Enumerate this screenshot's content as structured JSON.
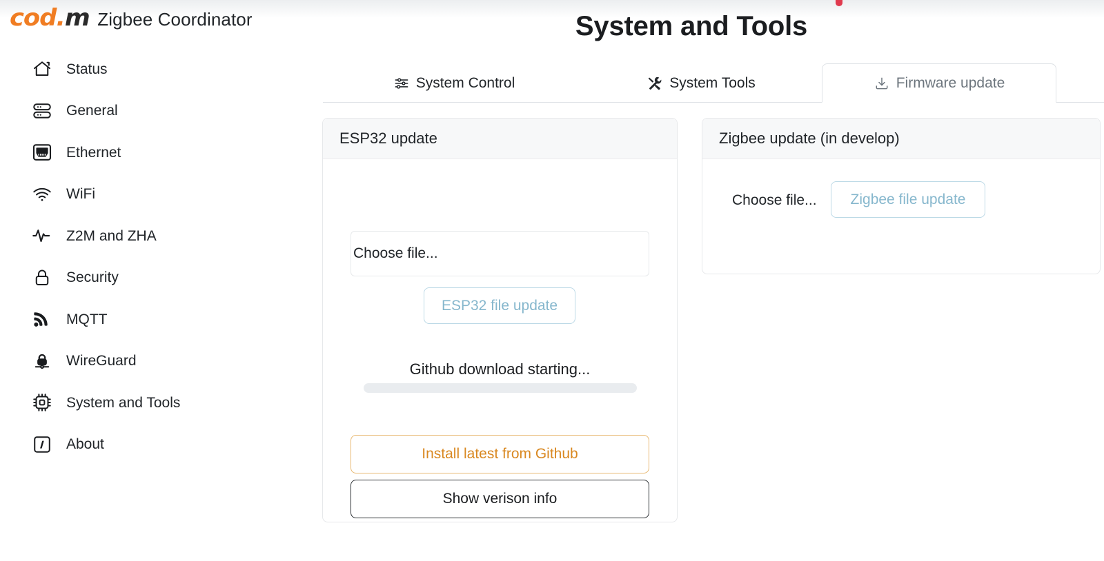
{
  "brand": {
    "logo_orange": "cod.",
    "logo_dark": "m",
    "title": "Zigbee Coordinator"
  },
  "sidebar": {
    "items": [
      {
        "label": "Status",
        "icon": "home-icon"
      },
      {
        "label": "General",
        "icon": "server-icon"
      },
      {
        "label": "Ethernet",
        "icon": "ethernet-port-icon"
      },
      {
        "label": "WiFi",
        "icon": "wifi-icon"
      },
      {
        "label": "Z2M and ZHA",
        "icon": "activity-pulse-icon"
      },
      {
        "label": "Security",
        "icon": "lock-icon"
      },
      {
        "label": "MQTT",
        "icon": "broadcast-icon"
      },
      {
        "label": "WireGuard",
        "icon": "wireguard-icon"
      },
      {
        "label": "System and Tools",
        "icon": "cpu-chip-icon"
      },
      {
        "label": "About",
        "icon": "info-square-icon"
      }
    ]
  },
  "main": {
    "page_title": "System and Tools",
    "tabs": [
      {
        "label": "System Control",
        "icon": "sliders-icon",
        "active": false
      },
      {
        "label": "System Tools",
        "icon": "tools-icon",
        "active": false
      },
      {
        "label": "Firmware update",
        "icon": "download-icon",
        "active": true
      }
    ],
    "esp32_card": {
      "header": "ESP32 update",
      "file_input_text": "Choose file...",
      "file_update_button": "ESP32 file update",
      "progress_label": "Github download starting...",
      "progress_percent": 0,
      "install_button": "Install latest from Github",
      "version_button": "Show verison info"
    },
    "zigbee_card": {
      "header": "Zigbee update (in develop)",
      "file_input_text": "Choose file...",
      "file_update_button": "Zigbee file update"
    }
  },
  "colors": {
    "brand_orange": "#f07d23",
    "warning": "#d98821",
    "info_disabled": "#86b7cd",
    "progress_track": "#e9ecef",
    "cursor_blip": "#e03a4e"
  }
}
